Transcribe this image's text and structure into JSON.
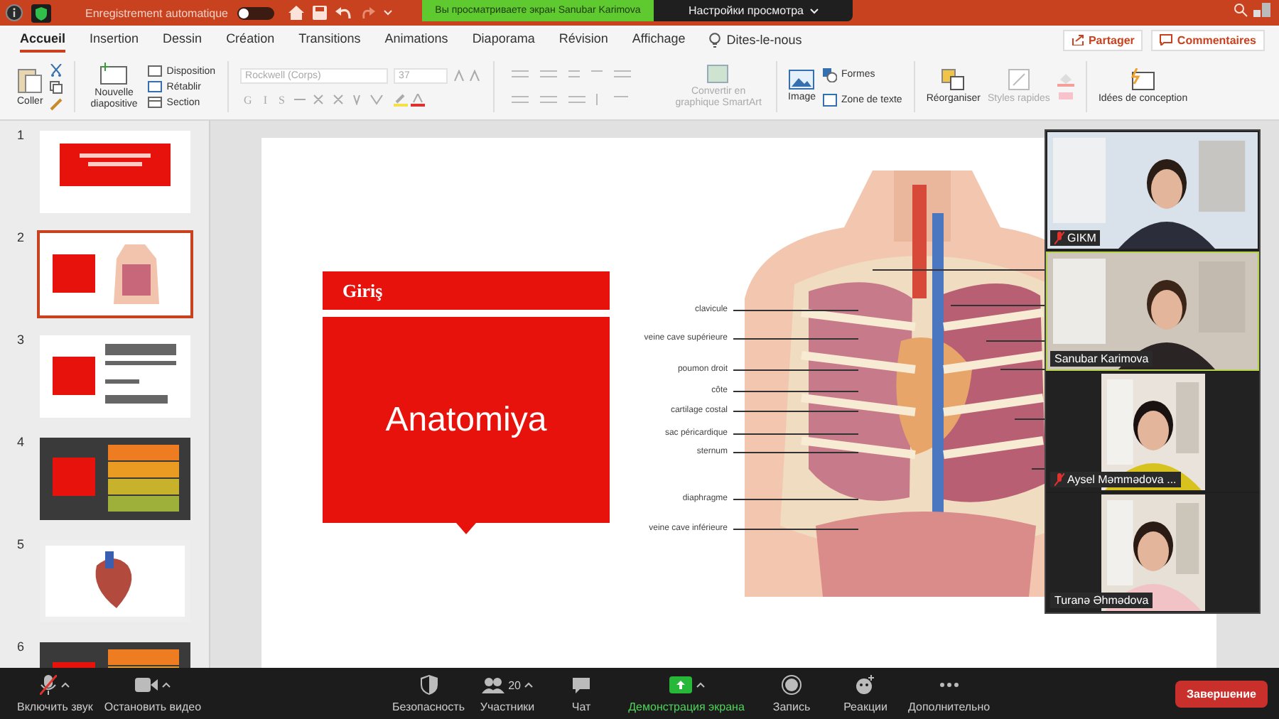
{
  "title_bar": {
    "autosave_label": "Enregistrement automatique",
    "autosave_on": false,
    "share_banner": "Вы просматриваете экран Sanubar Karimova",
    "view_options": "Настройки просмотра"
  },
  "tabs": [
    {
      "label": "Accueil",
      "selected": true
    },
    {
      "label": "Insertion",
      "selected": false
    },
    {
      "label": "Dessin",
      "selected": false
    },
    {
      "label": "Création",
      "selected": false
    },
    {
      "label": "Transitions",
      "selected": false
    },
    {
      "label": "Animations",
      "selected": false
    },
    {
      "label": "Diaporama",
      "selected": false
    },
    {
      "label": "Révision",
      "selected": false
    },
    {
      "label": "Affichage",
      "selected": false
    }
  ],
  "tell_me": "Dites-le-nous",
  "share_button": "Partager",
  "comments_button": "Commentaires",
  "ribbon": {
    "paste": "Coller",
    "new_slide": "Nouvelle diapositive",
    "layout": "Disposition",
    "reset": "Rétablir",
    "section": "Section",
    "font": "Rockwell (Corps)",
    "font_size": "37",
    "format_buttons": [
      "G",
      "I",
      "S"
    ],
    "smartart": "Convertir en graphique SmartArt",
    "image": "Image",
    "shapes": "Formes",
    "text_box": "Zone de texte",
    "arrange": "Réorganiser",
    "quick_styles": "Styles rapides",
    "design_ideas": "Idées de conception"
  },
  "slides": [
    {
      "number": "1",
      "kind": "title",
      "selected": false
    },
    {
      "number": "2",
      "kind": "anatomy",
      "selected": true
    },
    {
      "number": "3",
      "kind": "list",
      "selected": false
    },
    {
      "number": "4",
      "kind": "dark",
      "selected": false
    },
    {
      "number": "5",
      "kind": "heart",
      "selected": false
    },
    {
      "number": "6",
      "kind": "dark",
      "selected": false
    }
  ],
  "slide": {
    "header": "Giriş",
    "title": "Anatomiya",
    "labels": [
      "clavicule",
      "veine cave supérieure",
      "poumon droit",
      "côte",
      "cartilage costal",
      "sac péricardique",
      "sternum",
      "diaphragme",
      "veine cave inférieure"
    ]
  },
  "participants": [
    {
      "name": "GIKM",
      "muted": true,
      "speaking": false,
      "kind": "wide"
    },
    {
      "name": "Sanubar Karimova",
      "muted": false,
      "speaking": true,
      "kind": "wide"
    },
    {
      "name": "Aysel Məmmədova ...",
      "muted": true,
      "speaking": false,
      "kind": "narrow"
    },
    {
      "name": "Turanə Əhmədova",
      "muted": false,
      "speaking": false,
      "kind": "narrow"
    }
  ],
  "toolbar": [
    {
      "kind": "mic",
      "label": "Включить звук",
      "muted": true
    },
    {
      "kind": "video",
      "label": "Остановить видео"
    },
    {
      "kind": "security",
      "label": "Безопасность"
    },
    {
      "kind": "participants",
      "label": "Участники",
      "count": "20"
    },
    {
      "kind": "chat",
      "label": "Чат"
    },
    {
      "kind": "share",
      "label": "Демонстрация экрана",
      "active": true
    },
    {
      "kind": "record",
      "label": "Запись"
    },
    {
      "kind": "reactions",
      "label": "Реакции"
    },
    {
      "kind": "more",
      "label": "Дополнительно"
    }
  ],
  "end_button": "Завершение"
}
